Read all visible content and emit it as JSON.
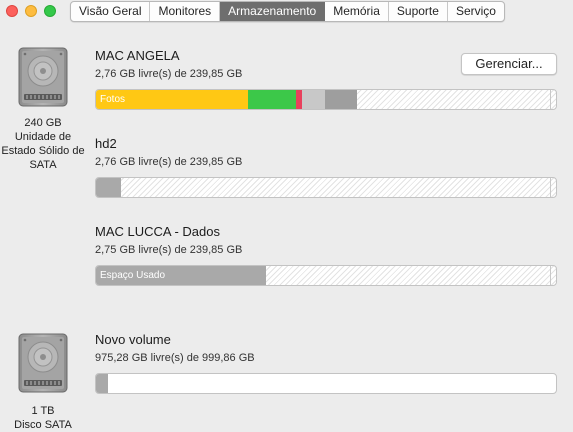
{
  "tabs": [
    {
      "label": "Visão Geral",
      "active": false
    },
    {
      "label": "Monitores",
      "active": false
    },
    {
      "label": "Armazenamento",
      "active": true
    },
    {
      "label": "Memória",
      "active": false
    },
    {
      "label": "Suporte",
      "active": false
    },
    {
      "label": "Serviço",
      "active": false
    }
  ],
  "drives": [
    {
      "icon": "hard-drive-icon",
      "caption": [
        "240 GB",
        "Unidade de",
        "Estado Sólido de",
        "SATA"
      ]
    },
    {
      "icon": "hard-drive-icon",
      "caption": [
        "1 TB",
        "Disco SATA"
      ]
    }
  ],
  "manage_button": {
    "label": "Gerenciar..."
  },
  "volumes": [
    {
      "name": "MAC ANGELA",
      "free": "2,76 GB livre(s) de 239,85 GB",
      "segments": [
        {
          "label": "Fotos",
          "fraction": 0.33,
          "color": "#ffc814"
        },
        {
          "label": "",
          "fraction": 0.105,
          "color": "#3cc849"
        },
        {
          "label": "",
          "fraction": 0.013,
          "color": "#e8405c"
        },
        {
          "label": "",
          "fraction": 0.05,
          "color": "#c8c8c8"
        },
        {
          "label": "",
          "fraction": 0.07,
          "color": "#9e9e9e"
        }
      ]
    },
    {
      "name": "hd2",
      "free": "2,76 GB livre(s) de 239,85 GB",
      "segments": [
        {
          "label": "",
          "fraction": 0.055,
          "color": "#a9a9a9"
        }
      ]
    },
    {
      "name": "MAC LUCCA - Dados",
      "free": "2,75 GB livre(s) de 239,85 GB",
      "segments": [
        {
          "label": "Espaço Usado",
          "fraction": 0.37,
          "color": "#a9a9a9"
        }
      ]
    },
    {
      "name": "Novo volume",
      "free": "975,28 GB livre(s) de 999,86 GB",
      "segments": [
        {
          "label": "",
          "fraction": 0.025,
          "color": "#a9a9a9"
        }
      ]
    }
  ]
}
